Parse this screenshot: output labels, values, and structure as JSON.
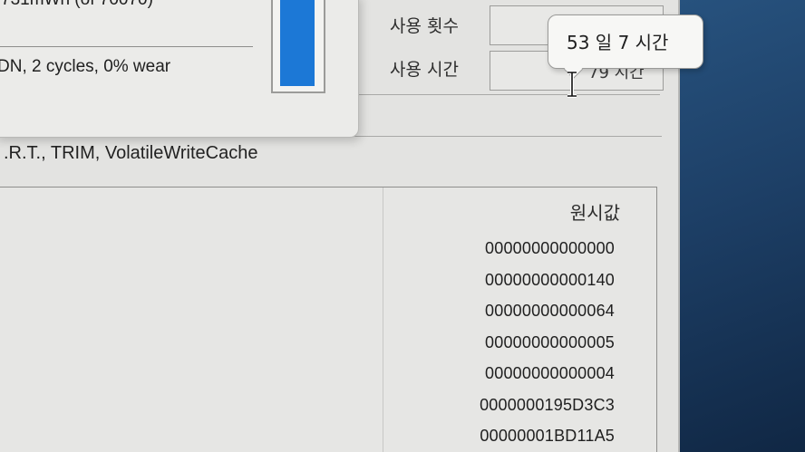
{
  "battery": {
    "capacity_line": "731mWh (of 70070)",
    "status_line": "DN, 2 cycles, 0% wear",
    "charge_level_percent": 95,
    "gauge_color": "#1c78d6"
  },
  "drive_info": {
    "power_on_count_label": "사용 횟수",
    "power_on_hours_label": "사용 시간",
    "power_on_hours_value": "79 시간",
    "features": ".R.T., TRIM, VolatileWriteCache"
  },
  "tooltip": {
    "text": "53 일 7 시간"
  },
  "smart_table": {
    "raw_value_header": "원시값",
    "raw_values": [
      "00000000000000",
      "00000000000140",
      "00000000000064",
      "00000000000005",
      "00000000000004",
      "0000000195D3C3",
      "00000001BD11A5"
    ]
  },
  "cursor": {
    "icon": "i-beam-cursor-icon"
  },
  "colors": {
    "wallpaper": "#1d3f66",
    "window_bg": "#e3e3e1",
    "accent": "#1c78d6"
  }
}
